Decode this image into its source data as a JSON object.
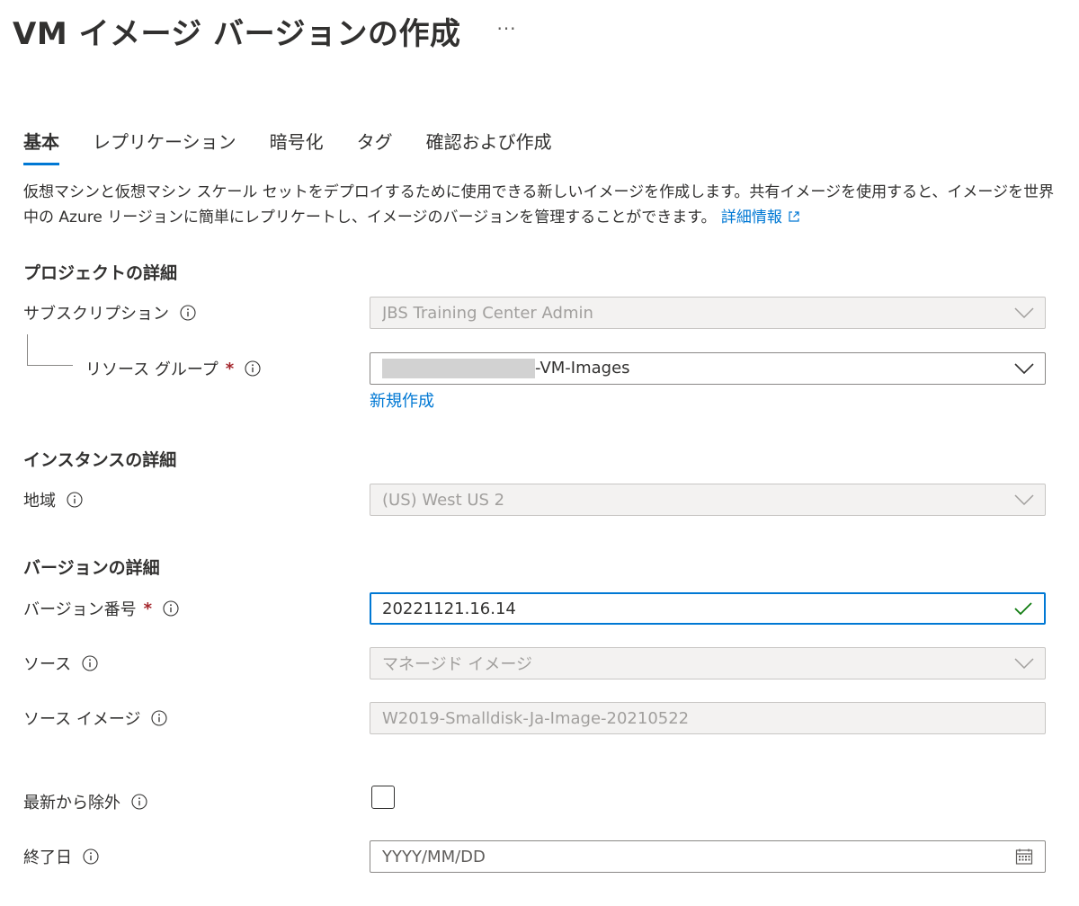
{
  "header": {
    "title": "VM イメージ バージョンの作成",
    "more": "···"
  },
  "tabs": [
    {
      "label": "基本",
      "active": true
    },
    {
      "label": "レプリケーション",
      "active": false
    },
    {
      "label": "暗号化",
      "active": false
    },
    {
      "label": "タグ",
      "active": false
    },
    {
      "label": "確認および作成",
      "active": false
    }
  ],
  "description": {
    "text": "仮想マシンと仮想マシン スケール セットをデプロイするために使用できる新しいイメージを作成します。共有イメージを使用すると、イメージを世界中の Azure リージョンに簡単にレプリケートし、イメージのバージョンを管理することができます。",
    "link": "詳細情報"
  },
  "sections": {
    "project": "プロジェクトの詳細",
    "instance": "インスタンスの詳細",
    "version": "バージョンの詳細"
  },
  "fields": {
    "subscription": {
      "label": "サブスクリプション",
      "value": "JBS Training Center Admin"
    },
    "resource_group": {
      "label": "リソース グループ",
      "required": "*",
      "value_suffix": "-VM-Images",
      "create_new": "新規作成"
    },
    "region": {
      "label": "地域",
      "value": "(US) West US 2"
    },
    "version_number": {
      "label": "バージョン番号",
      "required": "*",
      "value": "20221121.16.14"
    },
    "source": {
      "label": "ソース",
      "value": "マネージド イメージ"
    },
    "source_image": {
      "label": "ソース イメージ",
      "value": "W2019-Smalldisk-Ja-Image-20210522"
    },
    "exclude_latest": {
      "label": "最新から除外",
      "checked": false
    },
    "end_date": {
      "label": "終了日",
      "placeholder": "YYYY/MM/DD"
    }
  },
  "colors": {
    "accent": "#0078d4",
    "required": "#a4262c",
    "valid_check": "#107c10"
  }
}
